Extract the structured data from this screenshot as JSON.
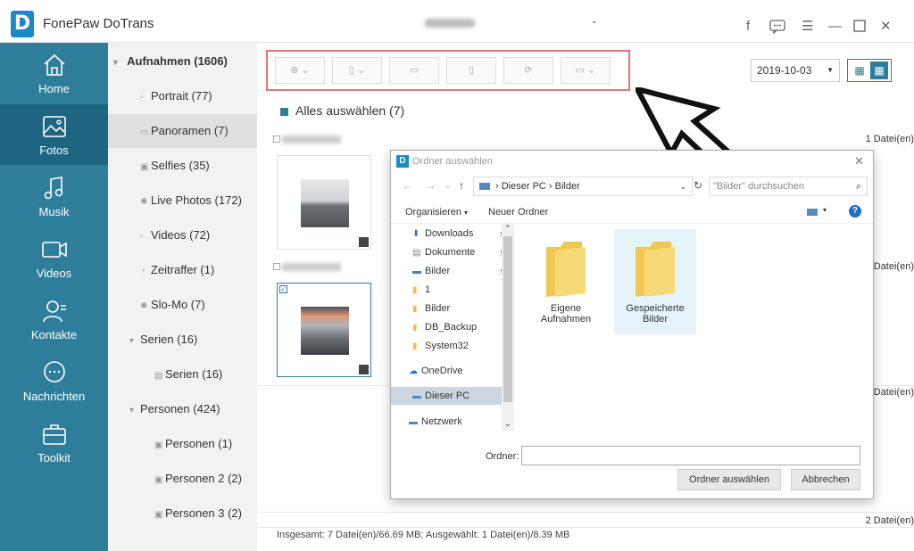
{
  "app": {
    "title": "FonePaw DoTrans",
    "logo_letter": "D"
  },
  "sidebar": {
    "items": [
      {
        "label": "Home",
        "icon": "home-icon"
      },
      {
        "label": "Fotos",
        "icon": "photo-icon",
        "active": true
      },
      {
        "label": "Musik",
        "icon": "music-icon"
      },
      {
        "label": "Videos",
        "icon": "video-icon"
      },
      {
        "label": "Kontakte",
        "icon": "contacts-icon"
      },
      {
        "label": "Nachrichten",
        "icon": "chat-icon"
      },
      {
        "label": "Toolkit",
        "icon": "toolkit-icon"
      }
    ]
  },
  "albums": {
    "items": [
      {
        "label": "Aufnahmen (1606)",
        "icon": "▾"
      },
      {
        "label": "Portrait (77)",
        "icon": "▫"
      },
      {
        "label": "Panoramen (7)",
        "icon": "▭"
      },
      {
        "label": "Selfies (35)",
        "icon": "▣"
      },
      {
        "label": "Live Photos (172)",
        "icon": "✺"
      },
      {
        "label": "Videos (72)",
        "icon": "▫"
      },
      {
        "label": "Zeitraffer (1)",
        "icon": "◔"
      },
      {
        "label": "Slo-Mo (7)",
        "icon": "✺"
      },
      {
        "label": "Serien (16)",
        "icon": "▾"
      },
      {
        "label": "Serien (16)",
        "icon": "▤"
      },
      {
        "label": "Personen (424)",
        "icon": "▾"
      },
      {
        "label": "Personen (1)",
        "icon": "▣"
      },
      {
        "label": "Personen 2 (2)",
        "icon": "▣"
      },
      {
        "label": "Personen 3 (2)",
        "icon": "▣"
      }
    ]
  },
  "main": {
    "date": "2019-10-03",
    "select_all": "Alles auswählen (7)",
    "groups": [
      {
        "count": "1 Datei(en)"
      },
      {
        "count": "Datei(en)"
      },
      {
        "count": "Datei(en)"
      },
      {
        "count": "2 Datei(en)"
      }
    ],
    "footer": "Insgesamt: 7 Datei(en)/66.69 MB; Ausgewählt: 1 Datei(en)/8.39 MB"
  },
  "dialog": {
    "title": "Ordner auswählen",
    "logo_letter": "D",
    "breadcrumb": [
      "Dieser PC",
      "Bilder"
    ],
    "search_placeholder": "\"Bilder\" durchsuchen",
    "organize": "Organisieren",
    "new_folder": "Neuer Ordner",
    "help": "?",
    "tree": [
      {
        "label": "Downloads",
        "pinned": true
      },
      {
        "label": "Dokumente",
        "pinned": true
      },
      {
        "label": "Bilder",
        "pinned": true
      },
      {
        "label": "1"
      },
      {
        "label": "Bilder"
      },
      {
        "label": "DB_Backup"
      },
      {
        "label": "System32"
      },
      {
        "label": "OneDrive"
      },
      {
        "label": "Dieser PC",
        "selected": true
      },
      {
        "label": "Netzwerk"
      }
    ],
    "folders": [
      {
        "line1": "Eigene",
        "line2": "Aufnahmen"
      },
      {
        "line1": "Gespeicherte",
        "line2": "Bilder",
        "selected": true
      }
    ],
    "folder_label": "Ordner:",
    "folder_value": "",
    "ok_button": "Ordner auswählen",
    "cancel_button": "Abbrechen"
  },
  "colors": {
    "accent": "#2e7d9a",
    "accent_dark": "#1d6580",
    "highlight": "#e87373"
  }
}
